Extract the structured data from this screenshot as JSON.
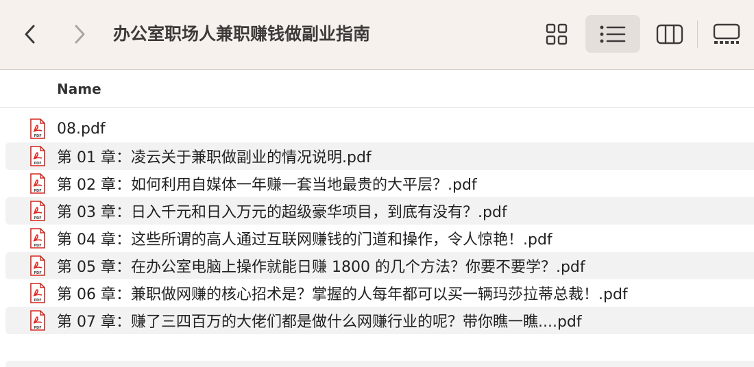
{
  "window": {
    "title": "办公室职场人兼职赚钱做副业指南"
  },
  "toolbar": {
    "back_icon": "chevron-left-icon",
    "forward_icon": "chevron-right-icon",
    "views": [
      "grid-view-icon",
      "list-view-icon",
      "column-view-icon",
      "gallery-view-icon"
    ],
    "active_view": "list-view-icon"
  },
  "columns": {
    "name": "Name"
  },
  "files": [
    {
      "name": "08.pdf"
    },
    {
      "name": "第 01 章：凌云关于兼职做副业的情况说明.pdf"
    },
    {
      "name": "第 02 章：如何利用自媒体一年赚一套当地最贵的大平层？.pdf"
    },
    {
      "name": "第 03 章：日入千元和日入万元的超级豪华项目，到底有没有？.pdf"
    },
    {
      "name": "第 04 章：这些所谓的高人通过互联网赚钱的门道和操作，令人惊艳！.pdf"
    },
    {
      "name": "第 05 章：在办公室电脑上操作就能日赚 1800 的几个方法？你要不要学？.pdf"
    },
    {
      "name": "第 06 章：兼职做网赚的核心招术是？掌握的人每年都可以买一辆玛莎拉蒂总裁！.pdf"
    },
    {
      "name": "第 07 章：赚了三四百万的大佬们都是做什么网赚行业的呢？带你瞧一瞧....pdf"
    }
  ],
  "colors": {
    "toolbar_bg": "#f7f1ee",
    "pdf_red": "#d9241c",
    "row_alt": "#f2f2f2"
  }
}
